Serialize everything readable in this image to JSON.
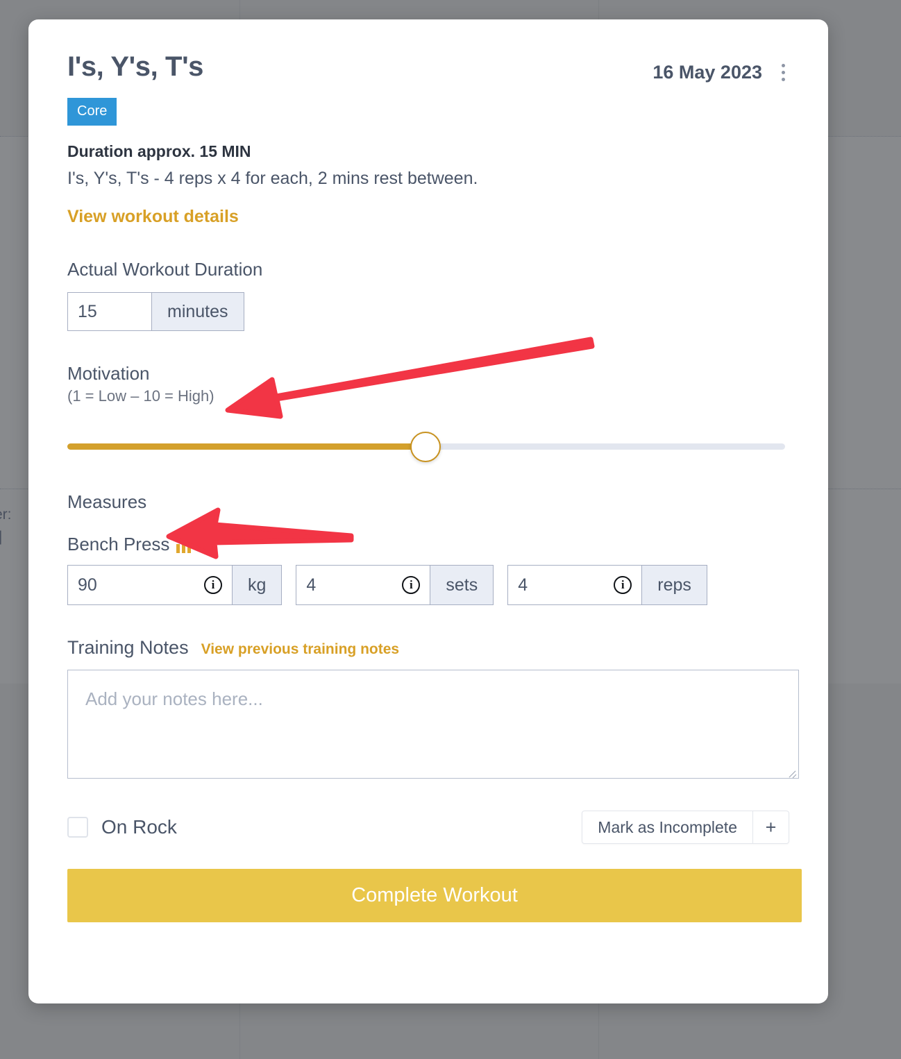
{
  "backdrop": {
    "partial_text_left_1": "er:",
    "partial_text_left_2": "|"
  },
  "modal": {
    "title": "I's, Y's, T's",
    "date": "16 May 2023",
    "menu_icon": "kebab-menu-icon",
    "badge": "Core",
    "duration_summary": "Duration approx. 15 MIN",
    "description": "I's, Y's, T's - 4 reps x 4 for each, 2 mins rest between.",
    "details_link": "View workout details",
    "duration": {
      "label": "Actual Workout Duration",
      "value": "15",
      "unit": "minutes"
    },
    "motivation": {
      "label": "Motivation",
      "scale_hint": "(1 = Low – 10 = High)",
      "value": 5,
      "min": 1,
      "max": 10,
      "fill_percent": 49,
      "track_color": "#e2e6ef",
      "fill_color": "#d3a02c",
      "thumb_color": "#ffffff"
    },
    "measures": {
      "label": "Measures",
      "exercise_name": "Bench Press",
      "exercise_icon": "bar-chart-icon",
      "fields": [
        {
          "value": "90",
          "unit": "kg",
          "info_icon": "info-icon"
        },
        {
          "value": "4",
          "unit": "sets",
          "info_icon": "info-icon"
        },
        {
          "value": "4",
          "unit": "reps",
          "info_icon": "info-icon"
        }
      ]
    },
    "notes": {
      "title": "Training Notes",
      "link": "View previous training notes",
      "placeholder": "Add your notes here...",
      "value": ""
    },
    "footer": {
      "checkbox_label": "On Rock",
      "checkbox_checked": false,
      "incomplete_button": "Mark as Incomplete",
      "plus_button": "+"
    },
    "cta": "Complete Workout"
  },
  "colors": {
    "badge_blue": "#2f96d8",
    "gold_link": "#d8a026",
    "cta_yellow": "#e9c64a",
    "text_slate": "#4a5568",
    "annotation_red": "#f23545"
  },
  "annotations": [
    {
      "name": "arrow-to-motivation",
      "color": "#f23545"
    },
    {
      "name": "arrow-to-measures",
      "color": "#f23545"
    }
  ]
}
